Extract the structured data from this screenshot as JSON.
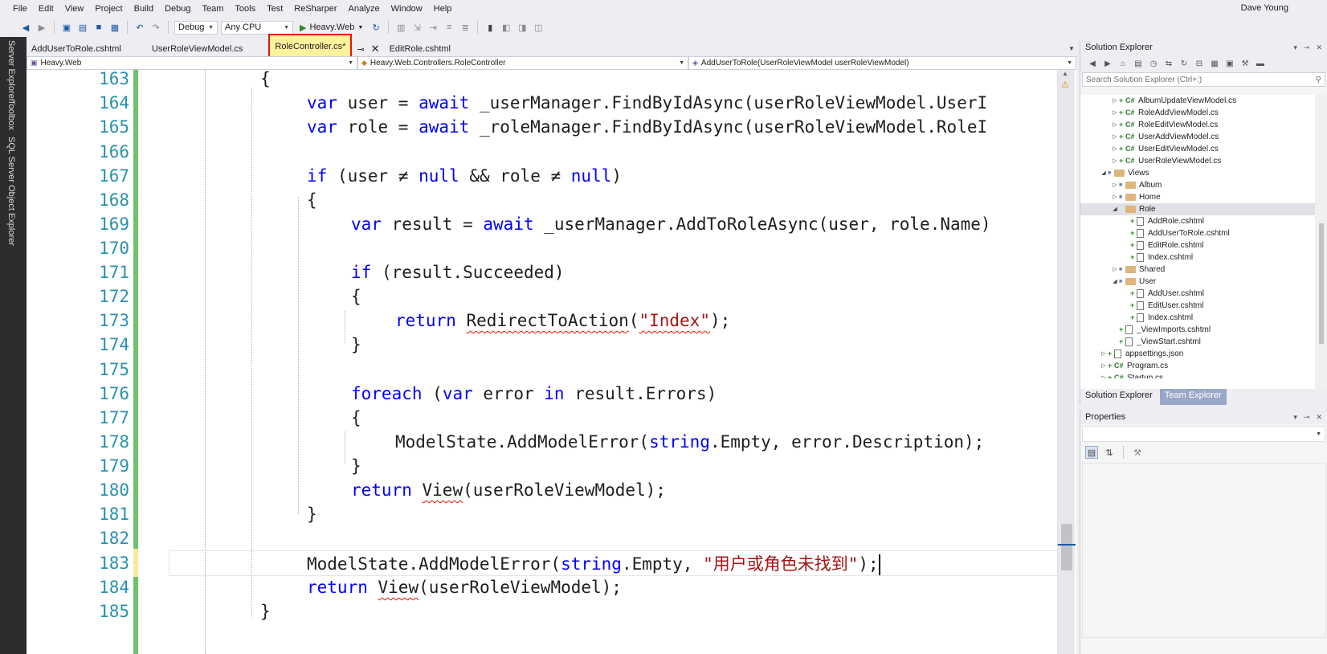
{
  "menu": [
    "File",
    "Edit",
    "View",
    "Project",
    "Build",
    "Debug",
    "Team",
    "Tools",
    "Test",
    "ReSharper",
    "Analyze",
    "Window",
    "Help"
  ],
  "user_name": "Dave Young",
  "toolbar": {
    "config": "Debug",
    "platform": "Any CPU",
    "run_target": "Heavy.Web"
  },
  "left_strip": [
    "Server Explorer",
    "Toolbox",
    "SQL Server Object Explorer"
  ],
  "doc_tabs": [
    {
      "label": "AddUserToRole.cshtml"
    },
    {
      "label": "UserRoleViewModel.cs"
    },
    {
      "label": "RoleController.cs*"
    },
    {
      "label": "EditRole.cshtml"
    }
  ],
  "nav": {
    "project": "Heavy.Web",
    "type": "Heavy.Web.Controllers.RoleController",
    "member": "AddUserToRole(UserRoleViewModel userRoleViewModel)"
  },
  "code": {
    "line_numbers": [
      "163",
      "164",
      "165",
      "166",
      "167",
      "168",
      "169",
      "170",
      "171",
      "172",
      "173",
      "174",
      "175",
      "176",
      "177",
      "178",
      "179",
      "180",
      "181",
      "182",
      "183",
      "184",
      "185"
    ],
    "tokens": {
      "var": "var",
      "await": "await",
      "if": "if",
      "null": "null",
      "foreach": "foreach",
      "in": "in",
      "return": "return",
      "string": "string",
      "brace_open": "{",
      "brace_close": "}",
      "l164_a": "user = ",
      "l164_b": " _userManager.FindByIdAsync(userRoleViewModel.UserI",
      "l165_a": "role = ",
      "l165_b": " _roleManager.FindByIdAsync(userRoleViewModel.RoleI",
      "l167_a": "(user ≠ ",
      "l167_b": " && role ≠ ",
      "l167_c": ")",
      "l169_a": "result = ",
      "l169_b": " _userManager.AddToRoleAsync(user, role.Name)",
      "l171_a": "(result.Succeeded)",
      "redirect": "RedirectToAction",
      "l173_a": "(",
      "index_str": "\"Index\"",
      "l173_b": ");",
      "l176_a": "(",
      "l176_b": "error ",
      "l176_c": " result.Errors)",
      "l178_a": "ModelState.AddModelError(",
      "l178_b": ".Empty, error.Description);",
      "view": "View",
      "l180_a": "(userRoleViewModel);",
      "l183_a": "ModelState.AddModelError(",
      "l183_b": ".Empty, ",
      "l183_str": "\"用户或角色未找到\"",
      "l183_c": ");",
      "l184_a": "(userRoleViewModel);"
    }
  },
  "solution_explorer": {
    "title": "Solution Explorer",
    "search_placeholder": "Search Solution Explorer (Ctrl+;)",
    "items": [
      "AlbumUpdateViewModel.cs",
      "RoleAddViewModel.cs",
      "RoleEditViewModel.cs",
      "UserAddViewModel.cs",
      "UserEditViewModel.cs",
      "UserRoleViewModel.cs",
      "Views",
      "Album",
      "Home",
      "Role",
      "AddRole.cshtml",
      "AddUserToRole.cshtml",
      "EditRole.cshtml",
      "Index.cshtml",
      "Shared",
      "User",
      "AddUser.cshtml",
      "EditUser.cshtml",
      "Index.cshtml",
      "_ViewImports.cshtml",
      "_ViewStart.cshtml",
      "appsettings.json",
      "Program.cs",
      "Startup.cs"
    ],
    "tabs": [
      "Solution Explorer",
      "Team Explorer"
    ]
  },
  "properties": {
    "title": "Properties"
  },
  "colors": {
    "keyword": "#0000ff",
    "string": "#a31515",
    "line_number": "#2b91af",
    "active_tab_bg": "#fff29d",
    "highlight_border": "#e51400",
    "change_bar": "#6cc36c"
  }
}
